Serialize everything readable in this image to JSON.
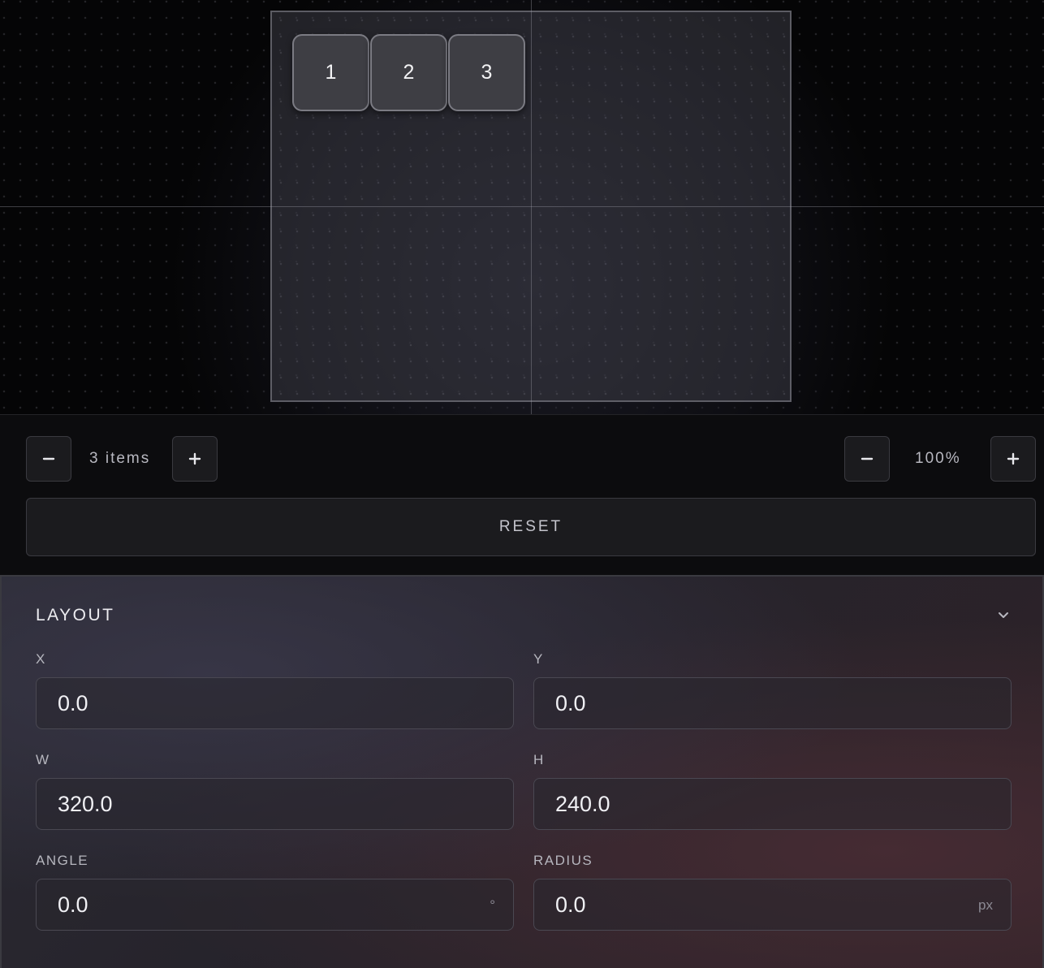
{
  "canvas": {
    "items": [
      {
        "label": "1"
      },
      {
        "label": "2"
      },
      {
        "label": "3"
      }
    ]
  },
  "controls": {
    "items_minus_icon": "minus-icon",
    "items_label": "3 items",
    "items_plus_icon": "plus-icon",
    "zoom_minus_icon": "minus-icon",
    "zoom_label": "100%",
    "zoom_plus_icon": "plus-icon",
    "reset_label": "RESET"
  },
  "panel": {
    "title": "LAYOUT",
    "collapse_icon": "chevron-down-icon",
    "fields": {
      "x": {
        "label": "X",
        "value": "0.0"
      },
      "y": {
        "label": "Y",
        "value": "0.0"
      },
      "w": {
        "label": "W",
        "value": "320.0"
      },
      "h": {
        "label": "H",
        "value": "240.0"
      },
      "angle": {
        "label": "ANGLE",
        "value": "0.0",
        "unit": "°"
      },
      "radius": {
        "label": "RADIUS",
        "value": "0.0",
        "unit": "px"
      }
    }
  },
  "colors": {
    "background": "#050506",
    "panel": "#2a2a33",
    "button": "#1b1b1e",
    "item": "#3e3e44"
  }
}
